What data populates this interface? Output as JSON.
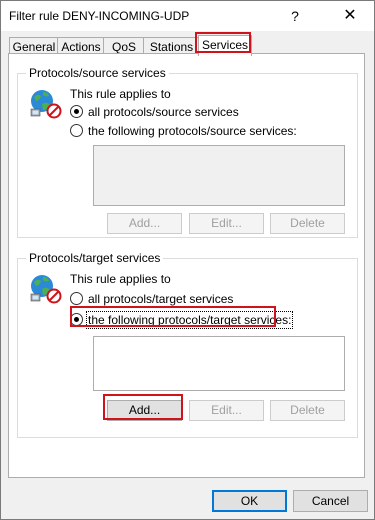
{
  "window": {
    "title": "Filter rule DENY-INCOMING-UDP",
    "help_glyph": "?",
    "close_glyph": "✕"
  },
  "tabs": [
    {
      "label": "General",
      "active": false
    },
    {
      "label": "Actions",
      "active": false
    },
    {
      "label": "QoS",
      "active": false
    },
    {
      "label": "Stations",
      "active": false
    },
    {
      "label": "Services",
      "active": true
    }
  ],
  "source_group": {
    "title": "Protocols/source services",
    "applies_to": "This rule applies to",
    "option_all": "all protocols/source services",
    "option_following": "the following protocols/source services:",
    "selected": "all",
    "add_label": "Add...",
    "edit_label": "Edit...",
    "delete_label": "Delete"
  },
  "target_group": {
    "title": "Protocols/target services",
    "applies_to": "This rule applies to",
    "option_all": "all protocols/target services",
    "option_following": "the following protocols/target services:",
    "selected": "following",
    "add_label": "Add...",
    "edit_label": "Edit...",
    "delete_label": "Delete"
  },
  "footer": {
    "ok_label": "OK",
    "cancel_label": "Cancel"
  },
  "colors": {
    "highlight": "#d0121b",
    "default_button": "#0078d7"
  }
}
